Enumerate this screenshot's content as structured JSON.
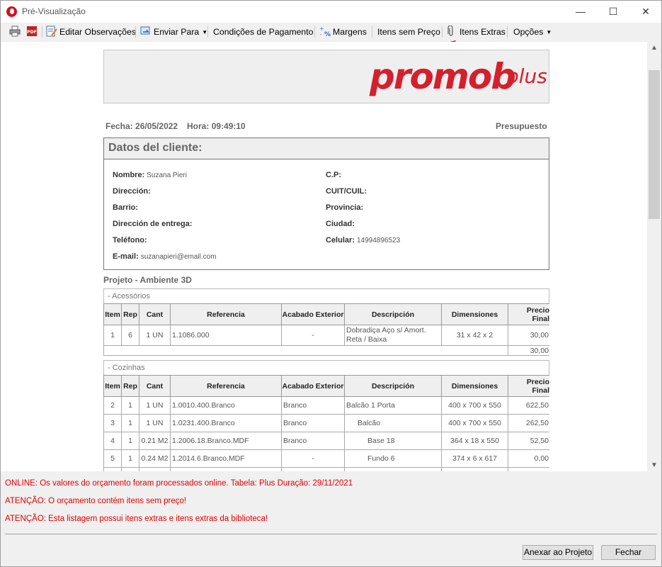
{
  "window": {
    "title": "Pré-Visualização",
    "controls": {
      "minimize": "—",
      "maximize": "☐",
      "close": "✕"
    }
  },
  "toolbar": {
    "print_icon": "printer-icon",
    "pdf_icon": "pdf-icon",
    "pdf_label": "PDF",
    "edit_observations": "Editar Observações",
    "send_to": "Enviar Para",
    "payment_conditions": "Condições de Pagamento",
    "margins": "Margens",
    "items_without_price": "Itens sem Preço",
    "extra_items": "Itens Extras",
    "options": "Opções"
  },
  "document": {
    "logo_main": "promob",
    "logo_suffix": "plus",
    "fecha_label": "Fecha:",
    "fecha": "26/05/2022",
    "hora_label": "Hora:",
    "hora": "09:49:10",
    "doc_type": "Presupuesto",
    "client": {
      "heading": "Datos del cliente:",
      "nombre_label": "Nombre:",
      "nombre": "Suzana Pieri",
      "direccion_label": "Dirección:",
      "barrio_label": "Barrio:",
      "entrega_label": "Dirección de entrega:",
      "telefono_label": "Teléfono:",
      "email_label": "E-mail:",
      "email": "suzanapieri@email.com",
      "cp_label": "C.P:",
      "cuit_label": "CUIT/CUIL:",
      "provincia_label": "Provincia:",
      "ciudad_label": "Ciudad:",
      "celular_label": "Celular:",
      "celular": "14994896523"
    },
    "project_title": "Projeto - Ambiente 3D",
    "columns": [
      "Item",
      "Rep",
      "Cant",
      "Referencia",
      "Acabado Exterior",
      "Descripción",
      "Dimensiones",
      "Precio",
      "Final"
    ],
    "sections": [
      {
        "name": "- Acessórios",
        "rows": [
          [
            "1",
            "6",
            "1 UN",
            "1.1086.000",
            "-",
            "Dobradiça Aço s/ Amort. Reta / Baixa",
            "31 x 42 x 2",
            "30,00"
          ]
        ],
        "total": "30,00"
      },
      {
        "name": "- Cozinhas",
        "rows": [
          [
            "2",
            "1",
            "1 UN",
            "1.0010.400.Branco",
            "Branco",
            "Balcão 1 Porta",
            "400 x 700 x 550",
            "622,50"
          ],
          [
            "3",
            "1",
            "1 UN",
            "1.0231.400.Branco",
            "Branco",
            "Balcão",
            "400 x 700 x 550",
            "262,50"
          ],
          [
            "4",
            "1",
            "0.21 M2",
            "1.2006.18.Branco.MDF",
            "Branco",
            "Base 18",
            "364 x 18 x 550",
            "52,50"
          ],
          [
            "5",
            "1",
            "0.24 M2",
            "1.2014.6.Branco.MDF",
            "-",
            "Fundo 6",
            "374 x 6 x 617",
            "0,00"
          ]
        ]
      }
    ]
  },
  "status_messages": [
    "ONLINE: Os valores do orçamento foram processados online. Tabela:  Plus Duração: 29/11/2021",
    "ATENÇÃO: O orçamento contém itens sem preço!",
    "ATENÇÃO: Esta listagem possui itens extras e itens extras da biblioteca!"
  ],
  "buttons": {
    "attach": "Anexar ao Projeto",
    "close": "Fechar"
  },
  "colors": {
    "brand_red": "#d4202c",
    "warning_red": "#e00000",
    "annotation_arrow": "#e0101a"
  }
}
